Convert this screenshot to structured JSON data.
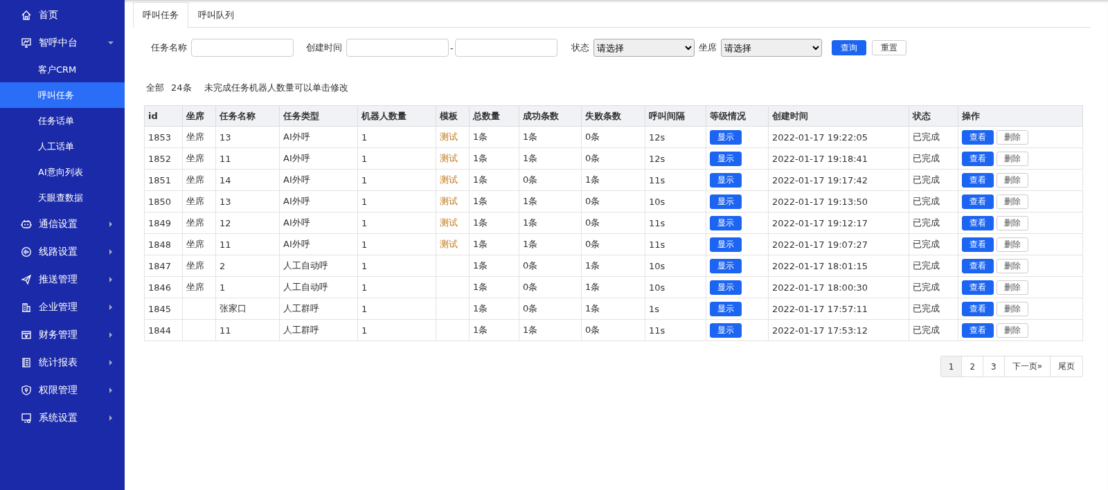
{
  "sidebar": {
    "items": [
      {
        "label": "首页"
      },
      {
        "label": "智呼中台",
        "expanded": true,
        "children": [
          {
            "label": "客户CRM",
            "selected": false
          },
          {
            "label": "呼叫任务",
            "selected": true
          },
          {
            "label": "任务话单",
            "selected": false
          },
          {
            "label": "人工话单",
            "selected": false
          },
          {
            "label": "AI意向列表",
            "selected": false
          },
          {
            "label": "天眼查数据",
            "selected": false
          }
        ]
      },
      {
        "label": "通信设置",
        "expanded": false
      },
      {
        "label": "线路设置",
        "expanded": false
      },
      {
        "label": "推送管理",
        "expanded": false
      },
      {
        "label": "企业管理",
        "expanded": false
      },
      {
        "label": "财务管理",
        "expanded": false
      },
      {
        "label": "统计报表",
        "expanded": false
      },
      {
        "label": "权限管理",
        "expanded": false
      },
      {
        "label": "系统设置",
        "expanded": false
      }
    ]
  },
  "tabs": [
    {
      "label": "呼叫任务",
      "selected": true
    },
    {
      "label": "呼叫队列",
      "selected": false
    }
  ],
  "filters": {
    "task_name": {
      "label": "任务名称"
    },
    "created_time": {
      "label": "创建时间",
      "separator": "-"
    },
    "status": {
      "label": "状态",
      "value": "请选择"
    },
    "seat": {
      "label": "坐席",
      "value": "请选择"
    },
    "buttons": [
      {
        "label": "查询",
        "kind": "primary"
      },
      {
        "label": "重置",
        "kind": "default"
      }
    ]
  },
  "summary": {
    "total_label": "全部",
    "total": "24条",
    "hint": "未完成任务机器人数量可以单击修改"
  },
  "table": {
    "columns": [
      "id",
      "坐席",
      "任务名称",
      "任务类型",
      "机器人数量",
      "模板",
      "总数量",
      "成功条数",
      "失败条数",
      "呼叫间隔",
      "等级情况",
      "创建时间",
      "状态",
      "操作"
    ],
    "rows": [
      {
        "id": "1853",
        "seat": "坐席",
        "name": "13",
        "type": "AI外呼",
        "robots": "1",
        "template": "测试",
        "total": "1条",
        "success": "1条",
        "fail": "0条",
        "interval": "12s",
        "level_button": "显示",
        "created": "2022-01-17 19:22:05",
        "status": "已完成",
        "actions": [
          "查看",
          "删除"
        ]
      },
      {
        "id": "1852",
        "seat": "坐席",
        "name": "11",
        "type": "AI外呼",
        "robots": "1",
        "template": "测试",
        "total": "1条",
        "success": "1条",
        "fail": "0条",
        "interval": "12s",
        "level_button": "显示",
        "created": "2022-01-17 19:18:41",
        "status": "已完成",
        "actions": [
          "查看",
          "删除"
        ]
      },
      {
        "id": "1851",
        "seat": "坐席",
        "name": "14",
        "type": "AI外呼",
        "robots": "1",
        "template": "测试",
        "total": "1条",
        "success": "0条",
        "fail": "1条",
        "interval": "11s",
        "level_button": "显示",
        "created": "2022-01-17 19:17:42",
        "status": "已完成",
        "actions": [
          "查看",
          "删除"
        ]
      },
      {
        "id": "1850",
        "seat": "坐席",
        "name": "13",
        "type": "AI外呼",
        "robots": "1",
        "template": "测试",
        "total": "1条",
        "success": "1条",
        "fail": "0条",
        "interval": "10s",
        "level_button": "显示",
        "created": "2022-01-17 19:13:50",
        "status": "已完成",
        "actions": [
          "查看",
          "删除"
        ]
      },
      {
        "id": "1849",
        "seat": "坐席",
        "name": "12",
        "type": "AI外呼",
        "robots": "1",
        "template": "测试",
        "total": "1条",
        "success": "1条",
        "fail": "0条",
        "interval": "11s",
        "level_button": "显示",
        "created": "2022-01-17 19:12:17",
        "status": "已完成",
        "actions": [
          "查看",
          "删除"
        ]
      },
      {
        "id": "1848",
        "seat": "坐席",
        "name": "11",
        "type": "AI外呼",
        "robots": "1",
        "template": "测试",
        "total": "1条",
        "success": "1条",
        "fail": "0条",
        "interval": "11s",
        "level_button": "显示",
        "created": "2022-01-17 19:07:27",
        "status": "已完成",
        "actions": [
          "查看",
          "删除"
        ]
      },
      {
        "id": "1847",
        "seat": "坐席",
        "name": "2",
        "type": "人工自动呼",
        "robots": "1",
        "total": "1条",
        "success": "0条",
        "fail": "1条",
        "interval": "10s",
        "level_button": "显示",
        "created": "2022-01-17 18:01:15",
        "status": "已完成",
        "actions": [
          "查看",
          "删除"
        ]
      },
      {
        "id": "1846",
        "seat": "坐席",
        "name": "1",
        "type": "人工自动呼",
        "robots": "1",
        "total": "1条",
        "success": "0条",
        "fail": "1条",
        "interval": "10s",
        "level_button": "显示",
        "created": "2022-01-17 18:00:30",
        "status": "已完成",
        "actions": [
          "查看",
          "删除"
        ]
      },
      {
        "id": "1845",
        "name": "张家口",
        "type": "人工群呼",
        "robots": "1",
        "total": "1条",
        "success": "0条",
        "fail": "1条",
        "interval": "1s",
        "level_button": "显示",
        "created": "2022-01-17 17:57:11",
        "status": "已完成",
        "actions": [
          "查看",
          "删除"
        ]
      },
      {
        "id": "1844",
        "name": "11",
        "type": "人工群呼",
        "robots": "1",
        "total": "1条",
        "success": "1条",
        "fail": "0条",
        "interval": "11s",
        "level_button": "显示",
        "created": "2022-01-17 17:53:12",
        "status": "已完成",
        "actions": [
          "查看",
          "删除"
        ]
      }
    ]
  },
  "pagination": {
    "pages": [
      {
        "label": "1",
        "selected": true
      },
      {
        "label": "2",
        "selected": false
      },
      {
        "label": "3",
        "selected": false
      }
    ],
    "next": "下一页»",
    "last": "尾页"
  }
}
